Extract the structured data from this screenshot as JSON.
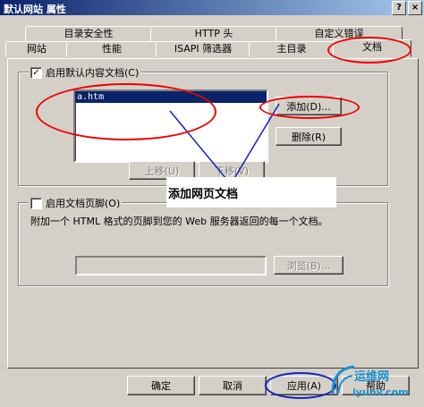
{
  "window": {
    "title": "默认网站 属性",
    "help_btn": "?",
    "close_btn": "×"
  },
  "tabs_row1": [
    "目录安全性",
    "HTTP 头",
    "自定义错误"
  ],
  "tabs_row2": [
    "网站",
    "性能",
    "ISAPI 筛选器",
    "主目录",
    "文档"
  ],
  "default_doc": {
    "checkbox_label": "启用默认内容文档(C)",
    "checked": true,
    "items": [
      "a.htm"
    ],
    "add_btn": "添加(D)...",
    "remove_btn": "删除(R)",
    "up_btn": "上移(U)",
    "down_btn": "下移(V)"
  },
  "footer_doc": {
    "checkbox_label": "启用文档页脚(O)",
    "checked": false,
    "description": "附加一个 HTML 格式的页脚到您的 Web 服务器返回的每一个文档。",
    "browse_btn": "浏览(B)..."
  },
  "buttons": {
    "ok": "确定",
    "cancel": "取消",
    "apply": "应用(A)",
    "help": "帮助"
  },
  "annotation": {
    "text": "添加网页文档"
  },
  "watermark": {
    "line1": "运维网",
    "line2": "iyunv.com"
  },
  "colors": {
    "annotation_red": "#e00000",
    "annotation_blue": "#1020c0",
    "selection": "#0a246a"
  }
}
